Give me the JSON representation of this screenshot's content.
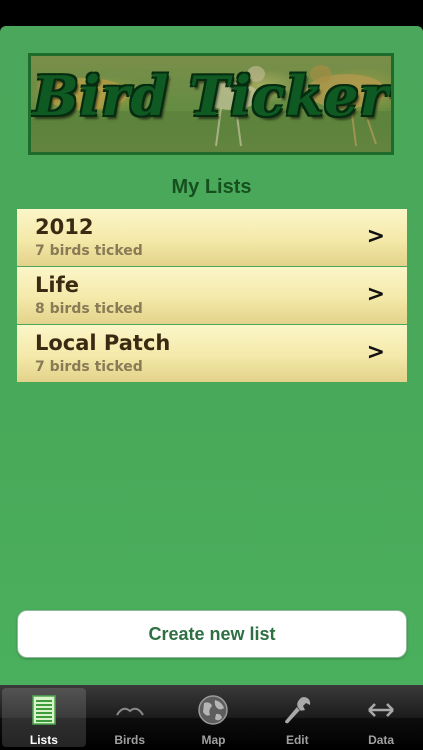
{
  "banner": {
    "title": "Bird Ticker"
  },
  "main": {
    "section_title": "My Lists",
    "lists": [
      {
        "title": "2012",
        "subtitle": "7 birds ticked"
      },
      {
        "title": "Life",
        "subtitle": "8 birds ticked"
      },
      {
        "title": "Local Patch",
        "subtitle": "7 birds ticked"
      }
    ],
    "chevron": ">",
    "create_label": "Create new list"
  },
  "tabbar": {
    "tabs": [
      {
        "label": "Lists",
        "icon": "lists-icon",
        "active": true
      },
      {
        "label": "Birds",
        "icon": "bird-icon",
        "active": false
      },
      {
        "label": "Map",
        "icon": "globe-icon",
        "active": false
      },
      {
        "label": "Edit",
        "icon": "wrench-icon",
        "active": false
      },
      {
        "label": "Data",
        "icon": "arrows-icon",
        "active": false
      }
    ]
  },
  "colors": {
    "background_green": "#4aa75b",
    "row_cream": "#f4e9a9",
    "title_green": "#17501f",
    "button_text": "#2e6f44"
  }
}
